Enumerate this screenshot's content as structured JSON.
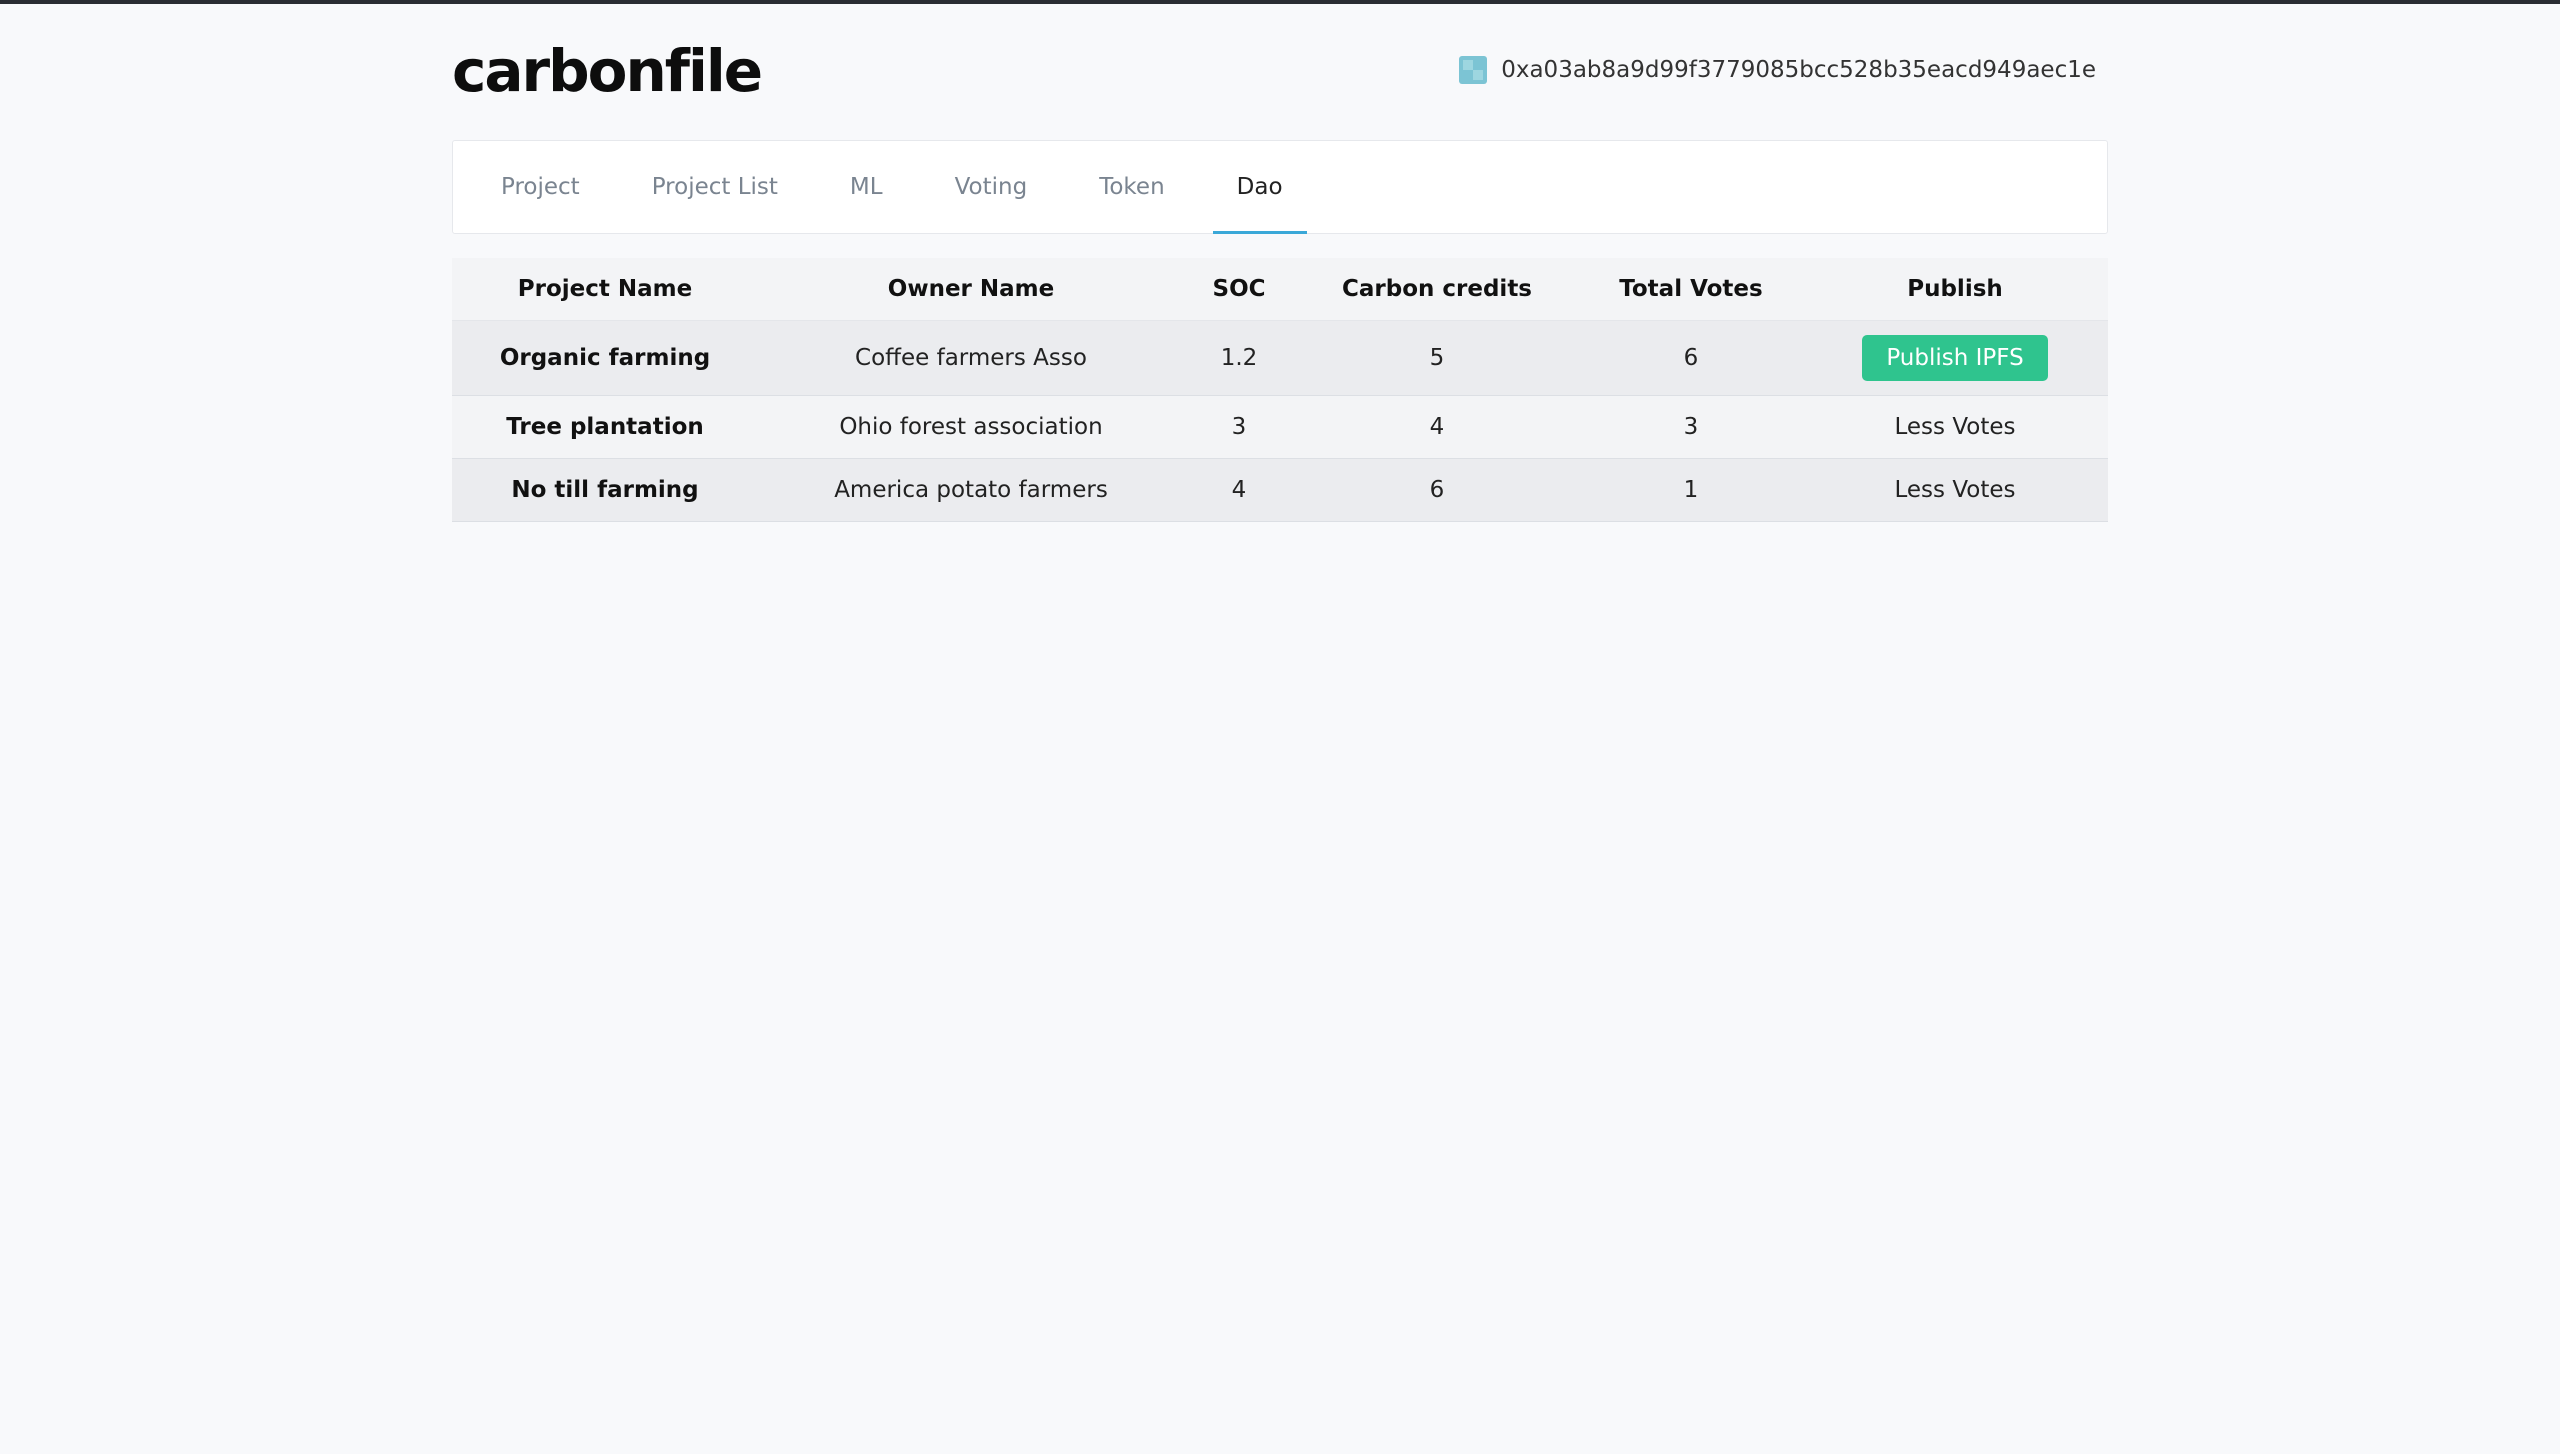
{
  "brand": {
    "logo_text": "carbonfile"
  },
  "account": {
    "address": "0xa03ab8a9d99f3779085bcc528b35eacd949aec1e",
    "icon": "identicon"
  },
  "tabs": [
    {
      "label": "Project",
      "active": false
    },
    {
      "label": "Project List",
      "active": false
    },
    {
      "label": "ML",
      "active": false
    },
    {
      "label": "Voting",
      "active": false
    },
    {
      "label": "Token",
      "active": false
    },
    {
      "label": "Dao",
      "active": true
    }
  ],
  "table": {
    "headers": [
      "Project Name",
      "Owner Name",
      "SOC",
      "Carbon credits",
      "Total Votes",
      "Publish"
    ],
    "rows": [
      {
        "project": "Organic farming",
        "owner": "Coffee farmers Asso",
        "soc": "1.2",
        "credits": "5",
        "votes": "6",
        "publish": "Publish IPFS"
      },
      {
        "project": "Tree plantation",
        "owner": "Ohio forest association",
        "soc": "3",
        "credits": "4",
        "votes": "3",
        "publish": "Less Votes"
      },
      {
        "project": "No till farming",
        "owner": "America potato farmers",
        "soc": "4",
        "credits": "6",
        "votes": "1",
        "publish": "Less Votes"
      }
    ]
  },
  "colors": {
    "accent": "#3aa8d8",
    "publish_button": "#2fc48e",
    "background": "#f8f9fb"
  }
}
